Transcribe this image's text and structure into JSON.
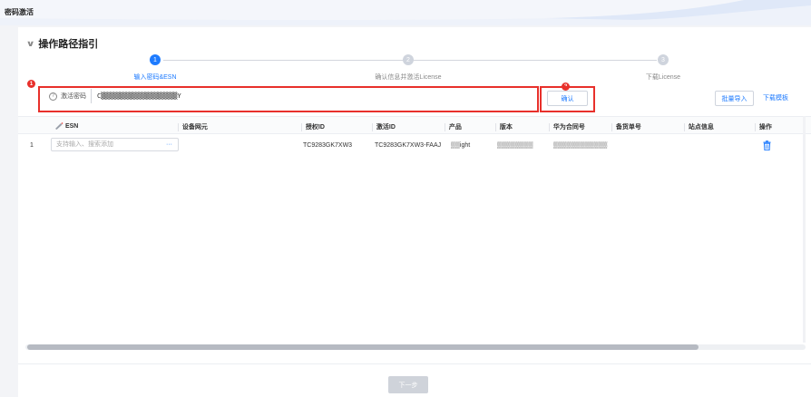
{
  "app": {
    "title": "密码激活"
  },
  "section": {
    "title": "操作路径指引"
  },
  "steps": [
    {
      "num": "1",
      "label": "输入密码&ESN",
      "state": "active"
    },
    {
      "num": "2",
      "label": "确认信息并激活License",
      "state": "inactive"
    },
    {
      "num": "3",
      "label": "下载License",
      "state": "inactive"
    }
  ],
  "badges": {
    "one": "1",
    "two": "2"
  },
  "password": {
    "label": "激活密码",
    "value": "C▒▒▒▒▒▒▒▒▒▒▒▒▒▒▒▒▒▒▒▒Y"
  },
  "buttons": {
    "confirm": "确认",
    "batch_import": "批量导入",
    "download_template": "下载模板",
    "next": "下一步"
  },
  "table": {
    "headers": [
      "ESN",
      "设备网元",
      "授权ID",
      "激活ID",
      "产品",
      "版本",
      "华为合同号",
      "备货单号",
      "站点信息",
      "操作"
    ],
    "rows": [
      {
        "index": "1",
        "esn_placeholder": "支持输入、搜索添加",
        "esn_more": "···",
        "device": "",
        "auth_id": "TC9283GK7XW3",
        "activation_id": "TC9283GK7XW3-FAAJ",
        "product": "▒▒ight",
        "version": "▒▒▒▒▒▒▒▒",
        "contract": "▒▒▒▒▒▒▒▒▒▒▒▒",
        "stock_no": "",
        "site": ""
      }
    ]
  },
  "colors": {
    "accent": "#1e7bff",
    "highlight": "#e8302b"
  },
  "icons": {
    "help": "question-circle-icon",
    "edit": "edit-icon",
    "delete": "trash-icon",
    "collapse": "chevron-down-icon"
  }
}
